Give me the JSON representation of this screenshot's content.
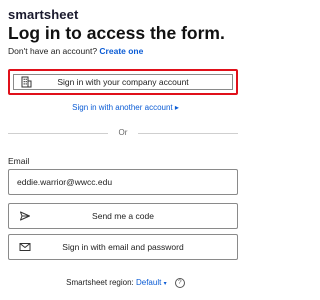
{
  "brand": {
    "logo_text": "smartsheet"
  },
  "header": {
    "title": "Log in to access the form."
  },
  "signup": {
    "prompt": "Don't have an account?",
    "link_label": "Create one"
  },
  "sso": {
    "company_button_label": "Sign in with your company account",
    "another_account_label": "Sign in with another account ▸"
  },
  "divider": {
    "label": "Or"
  },
  "email": {
    "label": "Email",
    "value": "eddie.warrior@wwcc.edu"
  },
  "actions": {
    "send_code_label": "Send me a code",
    "email_password_label": "Sign in with email and password"
  },
  "region": {
    "label": "Smartsheet region:",
    "selected": "Default",
    "caret": "▾",
    "help_glyph": "?"
  },
  "colors": {
    "link": "#0b5cd5",
    "highlight": "#e0101a"
  },
  "icons": [
    "building-icon",
    "send-icon",
    "envelope-icon",
    "help-icon",
    "caret-down-icon"
  ]
}
